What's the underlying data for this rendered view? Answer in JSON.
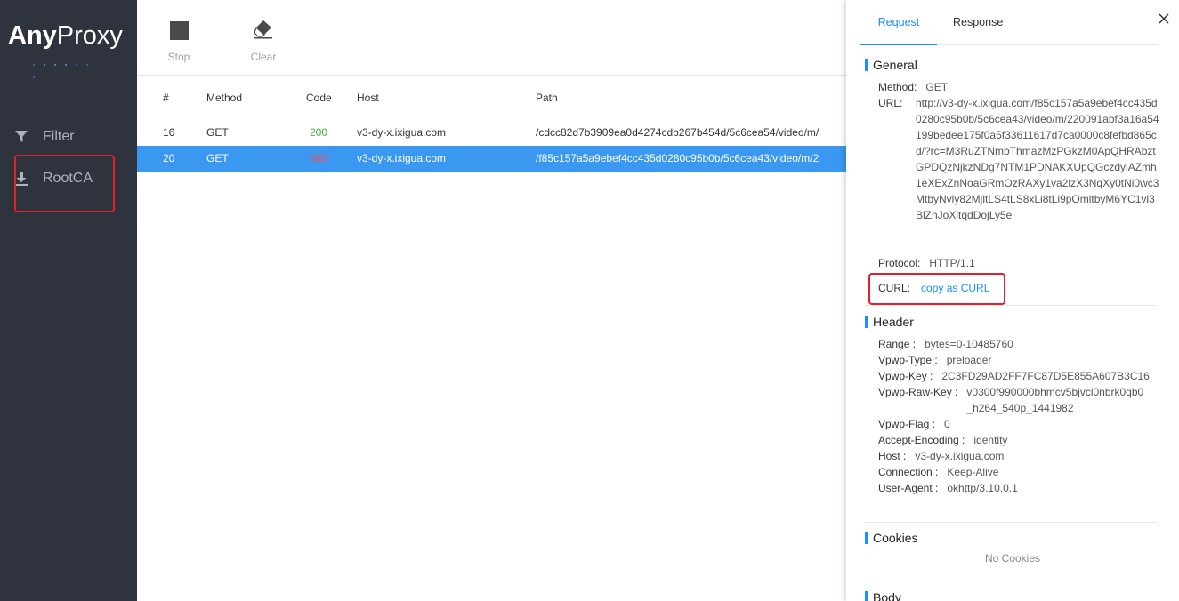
{
  "app": {
    "logo_bold": "Any",
    "logo_light": "Proxy"
  },
  "sidebar": {
    "items": [
      {
        "label": "Filter",
        "icon": "filter-icon"
      },
      {
        "label": "RootCA",
        "icon": "download-icon"
      }
    ]
  },
  "toolbar": {
    "stop_label": "Stop",
    "clear_label": "Clear"
  },
  "table": {
    "headers": [
      "#",
      "Method",
      "Code",
      "Host",
      "Path"
    ],
    "rows": [
      {
        "num": "16",
        "method": "GET",
        "code": "200",
        "host": "v3-dy-x.ixigua.com",
        "path": "/cdcc82d7b3909ea0d4274cdb267b454d/5c6cea54/video/m/"
      },
      {
        "num": "20",
        "method": "GET",
        "code": "500",
        "host": "v3-dy-x.ixigua.com",
        "path": "/f85c157a5a9ebef4cc435d0280c95b0b/5c6cea43/video/m/2"
      }
    ]
  },
  "detail": {
    "tabs": [
      "Request",
      "Response"
    ],
    "general": {
      "title": "General",
      "method_key": "Method:",
      "method_val": "GET",
      "url_key": "URL:",
      "url_val": "http://v3-dy-x.ixigua.com/f85c157a5a9ebef4cc435d0280c95b0b/5c6cea43/video/m/220091abf3a16a54199bedee175f0a5f33611617d7ca0000c8fefbd865cd/?rc=M3RuZTNmbThmazMzPGkzM0ApQHRAbztGPDQzNjkzNDg7NTM1PDNAKXUpQGczdylAZmh1eXExZnNoaGRmOzRAXy1va2lzX3NqXy0tNi0wc3MtbyNvly82MjltLS4tLS8xLi8tLi9pOmltbyM6YC1vl3BlZnJoXitqdDojLy5e",
      "protocol_key": "Protocol:",
      "protocol_val": "HTTP/1.1",
      "curl_key": "CURL:",
      "curl_val": "copy as CURL"
    },
    "header": {
      "title": "Header",
      "items": [
        {
          "key": "Range :",
          "val": "bytes=0-10485760"
        },
        {
          "key": "Vpwp-Type :",
          "val": "preloader"
        },
        {
          "key": "Vpwp-Key :",
          "val": "2C3FD29AD2FF7FC87D5E855A607B3C16"
        },
        {
          "key": "Vpwp-Raw-Key :",
          "val": "v0300f990000bhmcv5bjvcl0nbrk0qb0_h264_540p_1441982"
        },
        {
          "key": "Vpwp-Flag :",
          "val": "0"
        },
        {
          "key": "Accept-Encoding :",
          "val": "identity"
        },
        {
          "key": "Host :",
          "val": "v3-dy-x.ixigua.com"
        },
        {
          "key": "Connection :",
          "val": "Keep-Alive"
        },
        {
          "key": "User-Agent :",
          "val": "okhttp/3.10.0.1"
        }
      ]
    },
    "cookies": {
      "title": "Cookies",
      "empty_text": "No Cookies"
    },
    "body": {
      "title": "Body"
    }
  },
  "colors": {
    "sidebar_bg": "#2f333d",
    "accent": "#1890ff",
    "selected_row": "#3a98f0",
    "code_ok": "#3cb035",
    "code_err": "#e0202b",
    "highlight_box": "#e0202b"
  }
}
